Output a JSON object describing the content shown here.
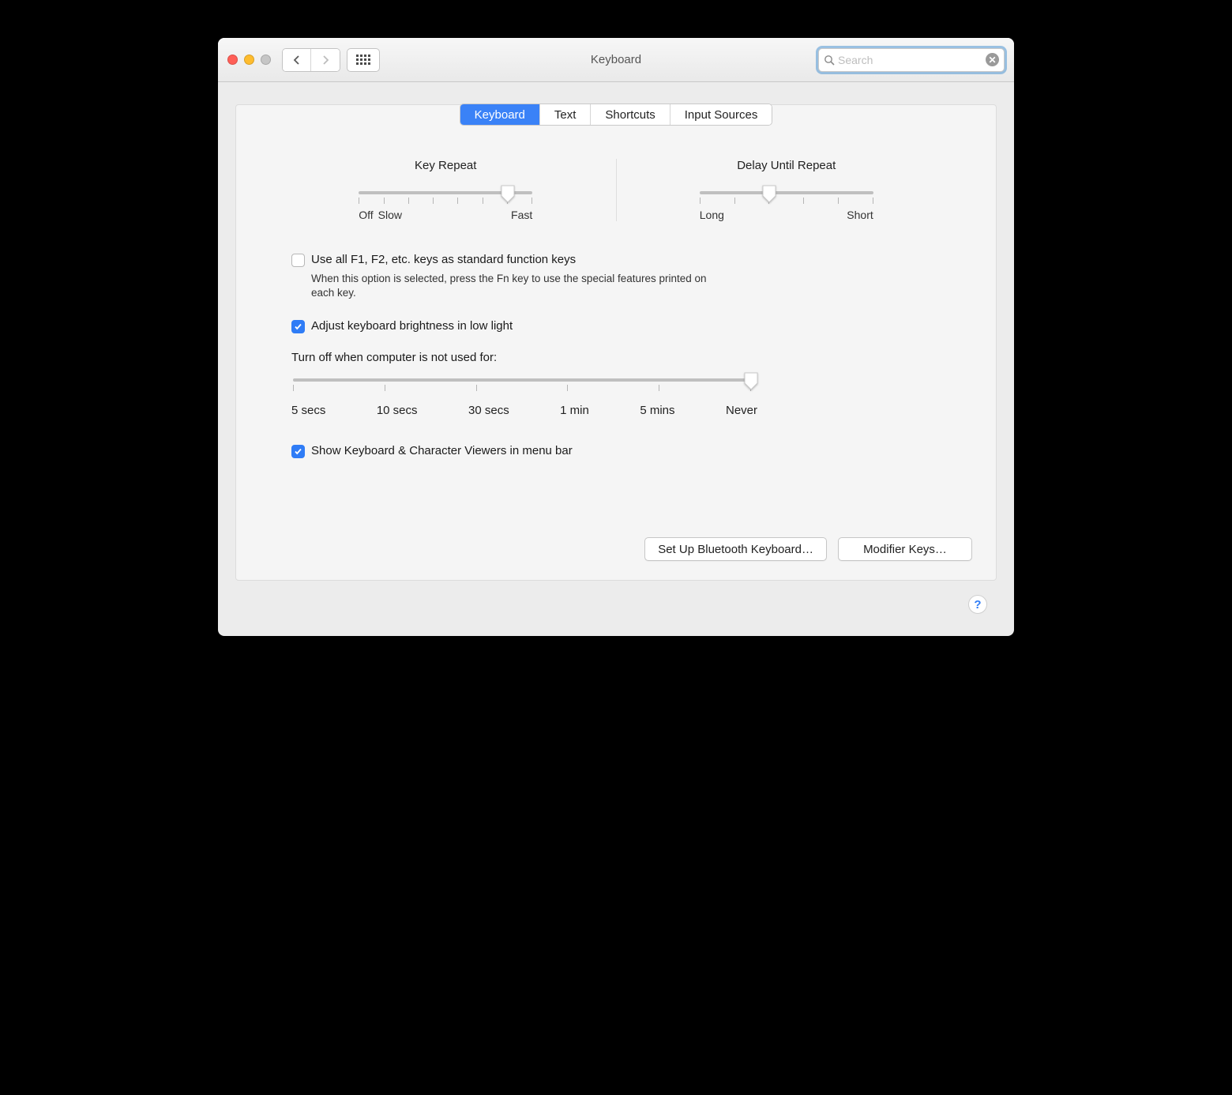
{
  "window": {
    "title": "Keyboard"
  },
  "search": {
    "placeholder": "Search",
    "value": ""
  },
  "tabs": {
    "t0": "Keyboard",
    "t1": "Text",
    "t2": "Shortcuts",
    "t3": "Input Sources",
    "active": 0
  },
  "sliders": {
    "key_repeat": {
      "title": "Key Repeat",
      "left_label_a": "Off",
      "left_label_b": "Slow",
      "right_label": "Fast",
      "ticks": 8,
      "value_index": 6
    },
    "delay_repeat": {
      "title": "Delay Until Repeat",
      "left_label": "Long",
      "right_label": "Short",
      "ticks": 6,
      "value_index": 2
    },
    "turnoff": {
      "ticks": 6,
      "value_index": 5,
      "labels": {
        "l0": "5 secs",
        "l1": "10 secs",
        "l2": "30 secs",
        "l3": "1 min",
        "l4": "5 mins",
        "l5": "Never"
      }
    }
  },
  "options": {
    "use_fn": {
      "checked": false,
      "label": "Use all F1, F2, etc. keys as standard function keys",
      "hint": "When this option is selected, press the Fn key to use the special features printed on each key."
    },
    "adjust_brightness": {
      "checked": true,
      "label": "Adjust keyboard brightness in low light"
    },
    "turnoff_label": "Turn off when computer is not used for:",
    "show_viewers": {
      "checked": true,
      "label": "Show Keyboard & Character Viewers in menu bar"
    }
  },
  "buttons": {
    "bluetooth": "Set Up Bluetooth Keyboard…",
    "modifier": "Modifier Keys…"
  },
  "help": "?"
}
